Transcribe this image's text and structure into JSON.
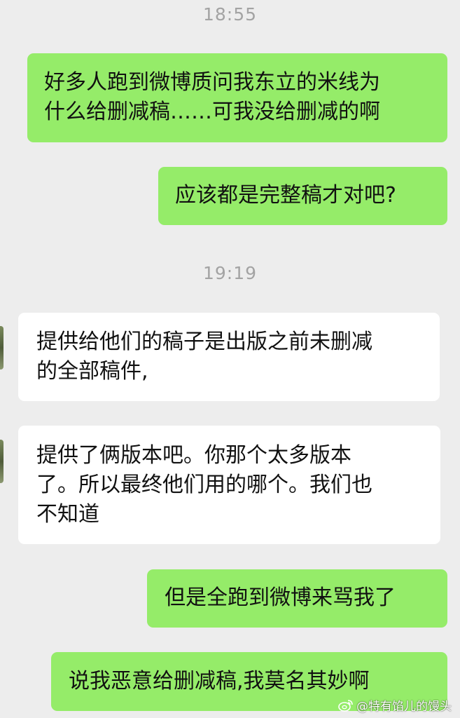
{
  "chat": {
    "timestamps": [
      "18:55",
      "19:19"
    ],
    "messages": [
      {
        "side": "out",
        "text": "好多人跑到微博质问我东立的米线为\n什么给删减稿……可我没给删减的啊"
      },
      {
        "side": "out",
        "text": "应该都是完整稿才对吧?"
      },
      {
        "side": "in",
        "text": "提供给他们的稿子是出版之前未删减\n的全部稿件,"
      },
      {
        "side": "in",
        "text": "提供了俩版本吧。你那个太多版本\n了。所以最终他们用的哪个。我们也\n不知道"
      },
      {
        "side": "out",
        "text": "但是全跑到微博来骂我了"
      },
      {
        "side": "out",
        "text": "说我恶意给删减稿,我莫名其妙啊"
      }
    ]
  },
  "watermark": {
    "text": "@特有馅儿的馒头",
    "icon": "weibo-icon"
  },
  "colors": {
    "background": "#ededed",
    "outgoing_bubble": "#95ec69",
    "incoming_bubble": "#ffffff",
    "timestamp_text": "#a3a3a3",
    "message_text": "#111111"
  }
}
